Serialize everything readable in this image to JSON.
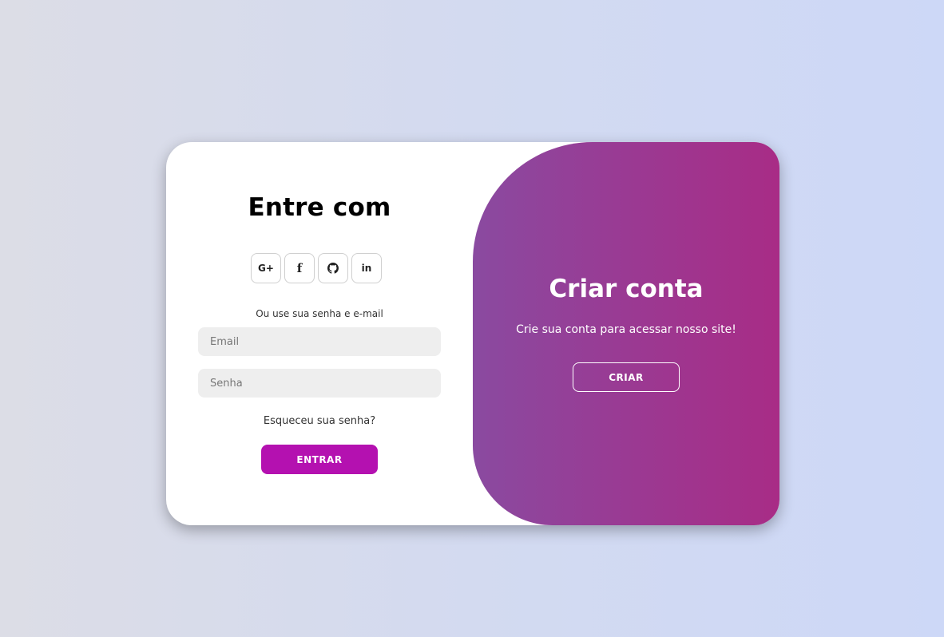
{
  "signin": {
    "title": "Entre com",
    "socials": [
      {
        "icon": "google-plus-icon",
        "glyph": "G+"
      },
      {
        "icon": "facebook-icon",
        "glyph": "f"
      },
      {
        "icon": "github-icon",
        "glyph": ""
      },
      {
        "icon": "linkedin-icon",
        "glyph": "in"
      }
    ],
    "alt_text": "Ou use sua senha e e-mail",
    "email_placeholder": "Email",
    "password_placeholder": "Senha",
    "forgot_text": "Esqueceu sua senha?",
    "enter_label": "ENTRAR"
  },
  "overlay": {
    "title": "Criar conta",
    "text": "Crie sua conta para acessar nosso site!",
    "create_label": "CRIAR"
  },
  "colors": {
    "primary": "#b411b0",
    "overlay_start": "#8a4aa0",
    "overlay_end": "#a82c86",
    "input_bg": "#eeeeee"
  }
}
